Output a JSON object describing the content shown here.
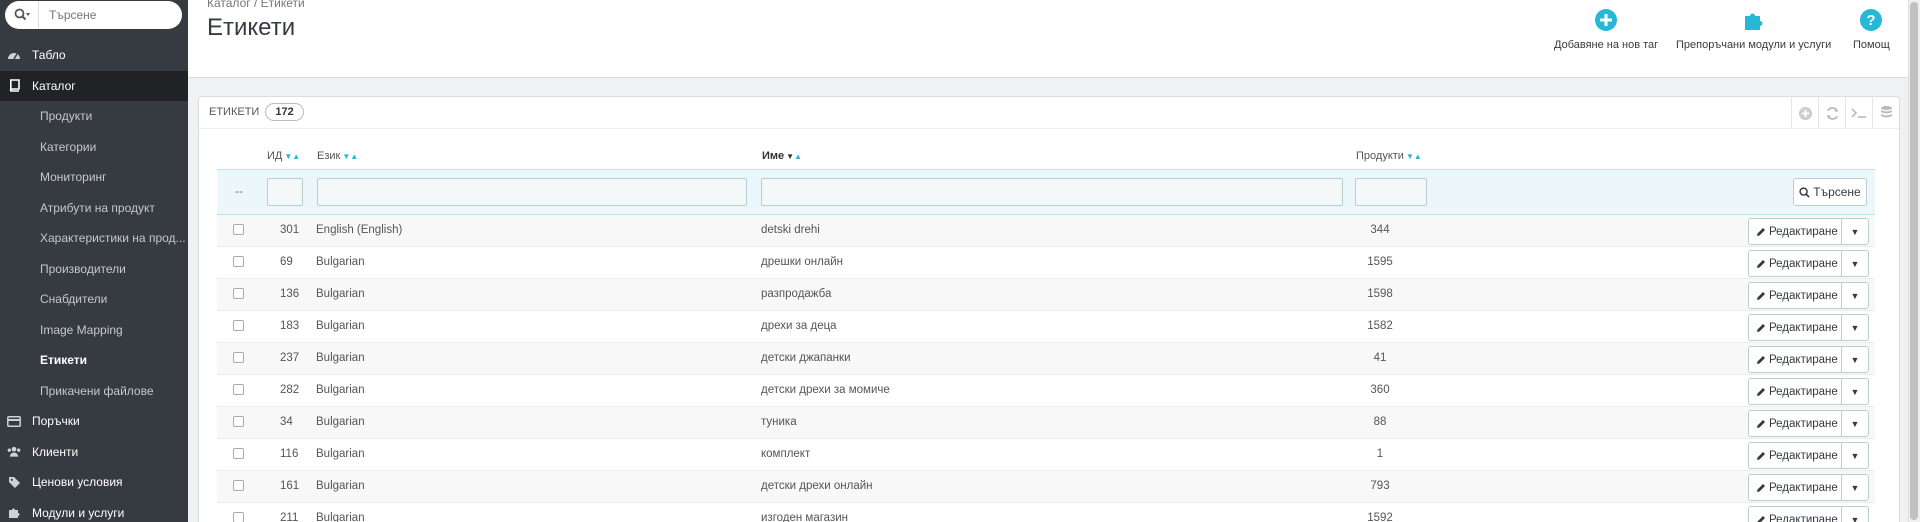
{
  "search": {
    "placeholder": "Търсене"
  },
  "sidebar": {
    "items": [
      {
        "label": "Табло",
        "icon": "dashboard-icon"
      },
      {
        "label": "Каталог",
        "icon": "book-icon"
      }
    ],
    "sub_items": [
      "Продукти",
      "Категории",
      "Мониторинг",
      "Атрибути на продукт",
      "Характеристики на прод...",
      "Производители",
      "Снабдители",
      "Image Mapping",
      "Етикети",
      "Прикачени файлове"
    ],
    "items_after": [
      {
        "label": "Поръчки",
        "icon": "credit-card-icon"
      },
      {
        "label": "Клиенти",
        "icon": "users-icon"
      },
      {
        "label": "Ценови условия",
        "icon": "tag-icon"
      },
      {
        "label": "Модули и услуги",
        "icon": "puzzle-icon"
      }
    ]
  },
  "header": {
    "breadcrumb": "Каталог  /  Етикети",
    "title": "Етикети",
    "add_label": "Добавяне на нов таг",
    "modules_label": "Препоръчани модули и услуги",
    "help_label": "Помощ"
  },
  "panel": {
    "title": "Етикети",
    "count": "172"
  },
  "table": {
    "columns": {
      "id": "ИД",
      "lang": "Език",
      "name": "Име",
      "products": "Продукти"
    },
    "filter_dash": "--",
    "search_button": "Търсене",
    "edit_label": "Редактиране",
    "rows": [
      {
        "id": "301",
        "lang": "English (English)",
        "name": "detski drehi",
        "products": "344"
      },
      {
        "id": "69",
        "lang": "Bulgarian",
        "name": "дрешки онлайн",
        "products": "1595"
      },
      {
        "id": "136",
        "lang": "Bulgarian",
        "name": "разпродажба",
        "products": "1598"
      },
      {
        "id": "183",
        "lang": "Bulgarian",
        "name": "дрехи за деца",
        "products": "1582"
      },
      {
        "id": "237",
        "lang": "Bulgarian",
        "name": "детски джапанки",
        "products": "41"
      },
      {
        "id": "282",
        "lang": "Bulgarian",
        "name": "детски дрехи за момиче",
        "products": "360"
      },
      {
        "id": "34",
        "lang": "Bulgarian",
        "name": "туника",
        "products": "88"
      },
      {
        "id": "116",
        "lang": "Bulgarian",
        "name": "комплект",
        "products": "1"
      },
      {
        "id": "161",
        "lang": "Bulgarian",
        "name": "детски дрехи онлайн",
        "products": "793"
      },
      {
        "id": "211",
        "lang": "Bulgarian",
        "name": "изгоден магазин",
        "products": "1592"
      }
    ]
  },
  "colors": {
    "accent": "#25b9d7",
    "sidebar": "#363a41",
    "sidebar_active": "#202226"
  }
}
